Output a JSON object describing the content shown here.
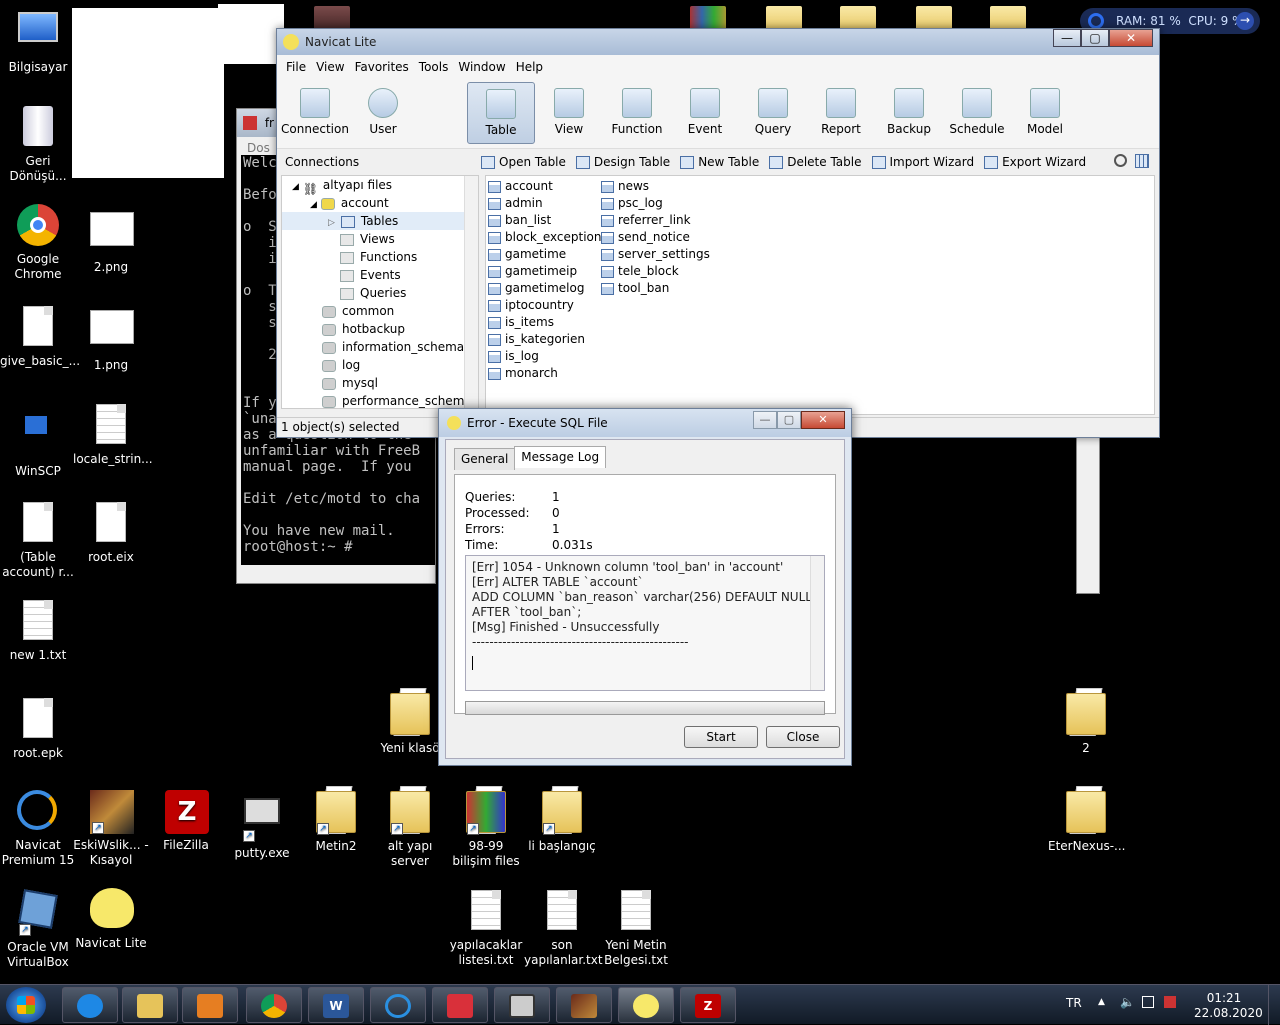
{
  "desktop": {
    "icons": [
      {
        "label": "Bilgisayar"
      },
      {
        "label": "Geri Dönüşü..."
      },
      {
        "label": "Google Chrome"
      },
      {
        "label": "2.png"
      },
      {
        "label": "give_basic_..."
      },
      {
        "label": "1.png"
      },
      {
        "label": "WinSCP"
      },
      {
        "label": "locale_strin..."
      },
      {
        "label": "(Table account) r..."
      },
      {
        "label": "root.eix"
      },
      {
        "label": "new 1.txt"
      },
      {
        "label": "root.epk"
      },
      {
        "label": "Yeni klasö"
      },
      {
        "label": "2"
      },
      {
        "label": "Navicat Premium 15"
      },
      {
        "label": "EskiWslik... - Kısayol"
      },
      {
        "label": "FileZilla"
      },
      {
        "label": "putty.exe"
      },
      {
        "label": "Metin2"
      },
      {
        "label": "alt yapı server"
      },
      {
        "label": "98-99 bilişim files"
      },
      {
        "label": "li başlangıç"
      },
      {
        "label": "EterNexus-..."
      },
      {
        "label": "Oracle VM VirtualBox"
      },
      {
        "label": "Navicat Lite"
      },
      {
        "label": "yapılacaklar listesi.txt"
      },
      {
        "label": "son yapılanlar.txt"
      },
      {
        "label": "Yeni Metin Belgesi.txt"
      }
    ]
  },
  "sysmon": {
    "ram": "RAM: 81 %",
    "cpu": "CPU: 9 %"
  },
  "terminal": {
    "title": "fr",
    "menu": "Dos",
    "lines": [
      "Welc",
      "",
      "Befo",
      "",
      "o  S",
      "   i",
      "   i",
      "",
      "o  T",
      "   s",
      "   s",
      "",
      "   2",
      "",
      "",
      "If y",
      "`una",
      "as a question to the",
      "unfamiliar with FreeB",
      "manual page.  If you",
      "",
      "Edit /etc/motd to cha",
      "",
      "You have new mail.",
      "root@host:~ #"
    ]
  },
  "navicat": {
    "title": "Navicat Lite",
    "menu": [
      "File",
      "View",
      "Favorites",
      "Tools",
      "Window",
      "Help"
    ],
    "toolbar": [
      {
        "label": "Connection"
      },
      {
        "label": "User"
      },
      {
        "label": "Table"
      },
      {
        "label": "View"
      },
      {
        "label": "Function"
      },
      {
        "label": "Event"
      },
      {
        "label": "Query"
      },
      {
        "label": "Report"
      },
      {
        "label": "Backup"
      },
      {
        "label": "Schedule"
      },
      {
        "label": "Model"
      }
    ],
    "connections_label": "Connections",
    "actions": [
      "Open Table",
      "Design Table",
      "New Table",
      "Delete Table",
      "Import Wizard",
      "Export Wizard"
    ],
    "tree": [
      {
        "label": "altyapı files",
        "level": 0
      },
      {
        "label": "account",
        "level": 1
      },
      {
        "label": "Tables",
        "level": 2
      },
      {
        "label": "Views",
        "level": 2
      },
      {
        "label": "Functions",
        "level": 2
      },
      {
        "label": "Events",
        "level": 2
      },
      {
        "label": "Queries",
        "level": 2
      },
      {
        "label": "common",
        "level": 1
      },
      {
        "label": "hotbackup",
        "level": 1
      },
      {
        "label": "information_schema",
        "level": 1
      },
      {
        "label": "log",
        "level": 1
      },
      {
        "label": "mysql",
        "level": 1
      },
      {
        "label": "performance_schema",
        "level": 1
      }
    ],
    "tables_col1": [
      "account",
      "admin",
      "ban_list",
      "block_exception",
      "gametime",
      "gametimeip",
      "gametimelog",
      "iptocountry",
      "is_items",
      "is_kategorien",
      "is_log",
      "monarch"
    ],
    "tables_col2": [
      "news",
      "psc_log",
      "referrer_link",
      "send_notice",
      "server_settings",
      "tele_block",
      "tool_ban"
    ],
    "status": "1 object(s) selected"
  },
  "dialog": {
    "title": "Error - Execute SQL File",
    "tabs": [
      "General",
      "Message Log"
    ],
    "stats": [
      {
        "key": "Queries:",
        "value": "1"
      },
      {
        "key": "Processed:",
        "value": "0"
      },
      {
        "key": "Errors:",
        "value": "1"
      },
      {
        "key": "Time:",
        "value": "0.031s"
      }
    ],
    "log": [
      "[Err] 1054 - Unknown column 'tool_ban' in 'account'",
      "[Err] ALTER TABLE `account`",
      "ADD COLUMN `ban_reason` varchar(256) DEFAULT NULL",
      "AFTER `tool_ban`;",
      "[Msg] Finished - Unsuccessfully",
      "--------------------------------------------------"
    ],
    "start_label": "Start",
    "close_label": "Close"
  },
  "taskbar": {
    "lang": "TR",
    "time": "01:21",
    "date": "22.08.2020"
  }
}
